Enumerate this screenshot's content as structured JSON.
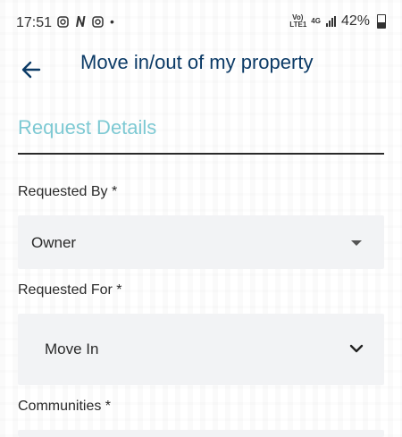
{
  "status_bar": {
    "time": "17:51",
    "notif_icons": [
      "instagram-icon",
      "n-app-icon",
      "instagram-icon"
    ],
    "dot": "•",
    "volte_label": "Vo) LTE1",
    "net_label": "4G",
    "battery_percent": "42%"
  },
  "header": {
    "title": "Move in/out of my property",
    "back_icon": "arrow-left-icon"
  },
  "section": {
    "title": "Request Details"
  },
  "form": {
    "requested_by": {
      "label": "Requested By *",
      "value": "Owner"
    },
    "requested_for": {
      "label": "Requested For *",
      "value": "Move In"
    },
    "communities": {
      "label": "Communities *"
    }
  },
  "colors": {
    "title": "#0b3a66",
    "section_title": "#7dc9d3",
    "field_bg": "#f2f3f5"
  }
}
